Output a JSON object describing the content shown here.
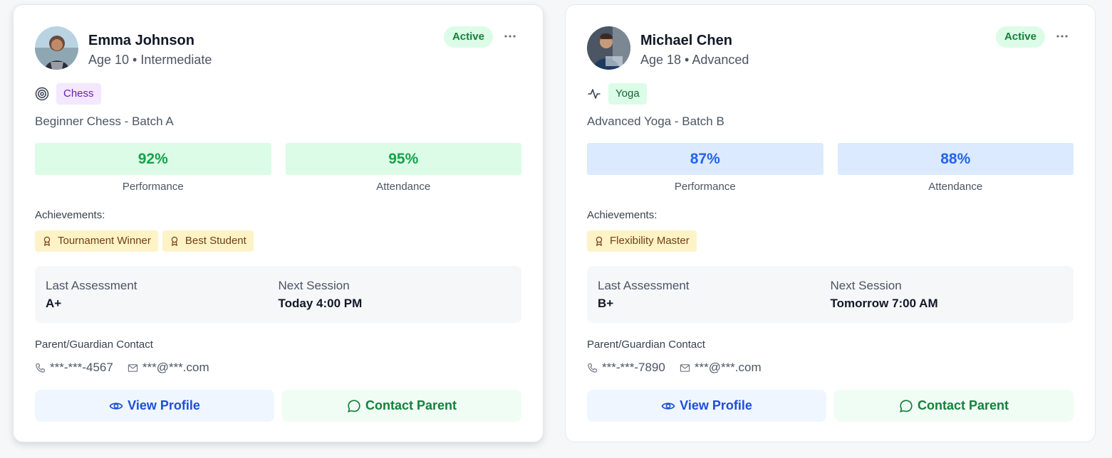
{
  "students": [
    {
      "name": "Emma Johnson",
      "meta": "Age 10 • Intermediate",
      "status": "Active",
      "sport": "Chess",
      "sport_icon": "target-icon",
      "sport_tag_bg": "#f3e8ff",
      "sport_tag_color": "#6b21a8",
      "batch": "Beginner Chess - Batch A",
      "performance": "92%",
      "performance_label": "Performance",
      "attendance": "95%",
      "attendance_label": "Attendance",
      "stat_bg": "#dcfce7",
      "stat_color": "#16a34a",
      "achievements_label": "Achievements:",
      "achievements": [
        "Tournament Winner",
        "Best Student"
      ],
      "last_assessment_label": "Last Assessment",
      "last_assessment": "A+",
      "next_session_label": "Next Session",
      "next_session": "Today 4:00 PM",
      "contact_label": "Parent/Guardian Contact",
      "phone": "***-***-4567",
      "email": "***@***.com",
      "view_label": "View Profile",
      "contact_button_label": "Contact Parent"
    },
    {
      "name": "Michael Chen",
      "meta": "Age 18 • Advanced",
      "status": "Active",
      "sport": "Yoga",
      "sport_icon": "activity-icon",
      "sport_tag_bg": "#dcfce7",
      "sport_tag_color": "#166534",
      "batch": "Advanced Yoga - Batch B",
      "performance": "87%",
      "performance_label": "Performance",
      "attendance": "88%",
      "attendance_label": "Attendance",
      "stat_bg": "#dbeafe",
      "stat_color": "#2563eb",
      "achievements_label": "Achievements:",
      "achievements": [
        "Flexibility Master"
      ],
      "last_assessment_label": "Last Assessment",
      "last_assessment": "B+",
      "next_session_label": "Next Session",
      "next_session": "Tomorrow 7:00 AM",
      "contact_label": "Parent/Guardian Contact",
      "phone": "***-***-7890",
      "email": "***@***.com",
      "view_label": "View Profile",
      "contact_button_label": "Contact Parent"
    }
  ]
}
